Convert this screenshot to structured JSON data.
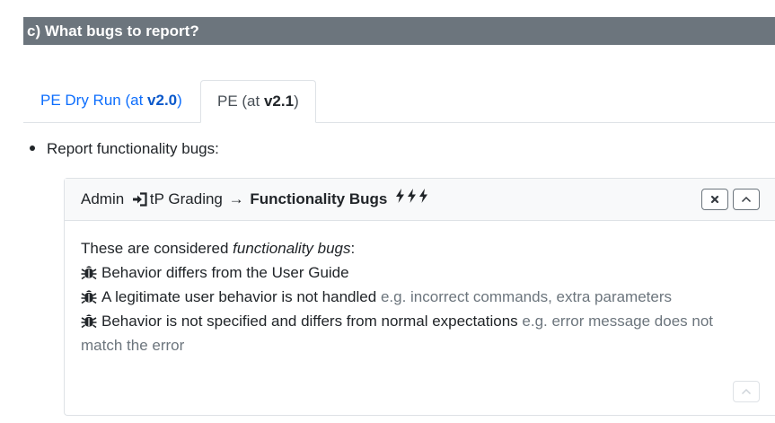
{
  "section": {
    "title": "c) What bugs to report?"
  },
  "tabs": [
    {
      "prefix": "PE Dry Run (at ",
      "version": "v2.0",
      "suffix": ")",
      "active": false
    },
    {
      "prefix": "PE (at ",
      "version": "v2.1",
      "suffix": ")",
      "active": true
    }
  ],
  "bullet": {
    "text": "Report functionality bugs:"
  },
  "card": {
    "breadcrumb_start": "Admin",
    "breadcrumb_icon": "login-icon",
    "breadcrumb_mid": "tP Grading",
    "arrow": "→",
    "breadcrumb_end": "Functionality Bugs",
    "bolt_icon": "lightning-bolt-icon",
    "bolt_count": 3,
    "buttons": {
      "close_icon": "close-icon",
      "collapse_icon": "chevron-up-icon",
      "footer_collapse_icon": "chevron-up-icon"
    },
    "body": {
      "intro_before": "These are considered ",
      "intro_em": "functionality bugs",
      "intro_after": ":",
      "bug_icon": "bug-icon",
      "items": [
        {
          "text": "Behavior differs from the User Guide",
          "example": ""
        },
        {
          "text": "A legitimate user behavior is not handled",
          "example": "e.g. incorrect commands, extra parameters"
        },
        {
          "text": "Behavior is not specified and differs from normal expectations",
          "example_line1": "e.g. error message does not",
          "example_line2": "match the error"
        }
      ]
    }
  },
  "colors": {
    "header_bg": "#6c757d",
    "link": "#0d6efd",
    "muted": "#6c757d",
    "border": "#dee2e6"
  }
}
